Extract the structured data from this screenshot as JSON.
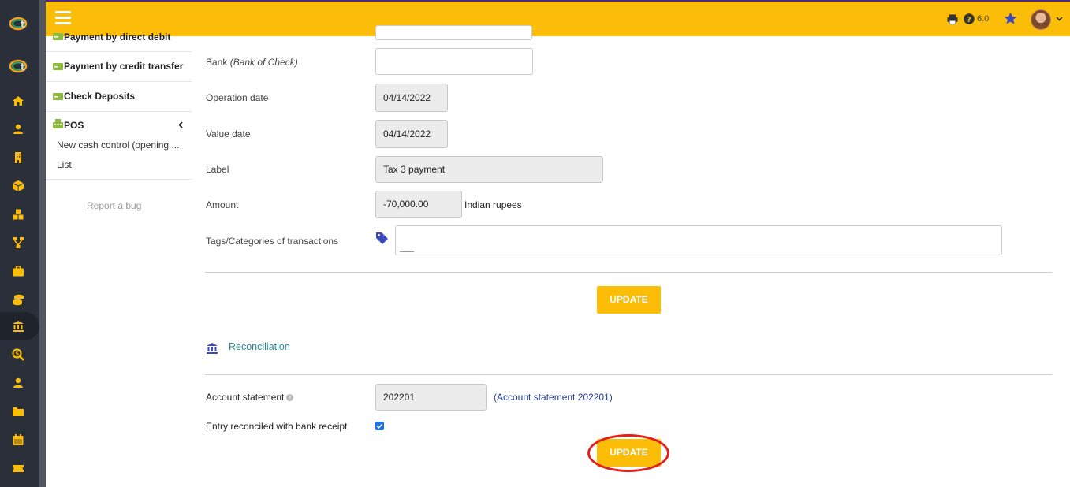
{
  "topbar": {
    "version": "6.0"
  },
  "leftmenu": {
    "items": [
      {
        "label": "Payment by direct debit"
      },
      {
        "label": "Payment by credit transfer"
      },
      {
        "label": "Check Deposits"
      },
      {
        "label": "POS"
      }
    ],
    "sub_items": [
      {
        "label": "New cash control (opening ..."
      },
      {
        "label": "List"
      }
    ],
    "report_bug": "Report a bug"
  },
  "form": {
    "bank_label": "Bank",
    "bank_hint": "(Bank of Check)",
    "bank_value": "",
    "operation_date_label": "Operation date",
    "operation_date": "04/14/2022",
    "value_date_label": "Value date",
    "value_date": "04/14/2022",
    "label_label": "Label",
    "label_value": "Tax 3 payment",
    "amount_label": "Amount",
    "amount": "-70,000.00",
    "currency": "Indian rupees",
    "tags_label": "Tags/Categories of transactions",
    "update_button": "UPDATE"
  },
  "reconciliation": {
    "title": "Reconciliation",
    "account_statement_label": "Account statement",
    "account_statement_value": "202201",
    "account_statement_link": "(Account statement 202201)",
    "reconciled_label": "Entry reconciled with bank receipt",
    "reconciled_checked": true,
    "update_button": "UPDATE"
  },
  "colors": {
    "accent": "#fbbd08",
    "rail": "#2a2f3a",
    "link": "#263c97",
    "highlight": "#e3201b"
  }
}
